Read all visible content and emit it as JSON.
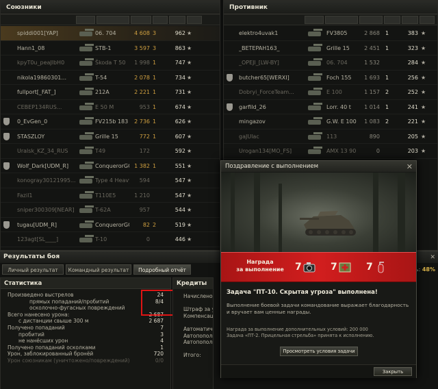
{
  "allies": {
    "title": "Союзники",
    "players": [
      {
        "name": "spiddi001[YAP]",
        "tank": "06. 704",
        "damage": "4 608",
        "kills": "3",
        "xp": "962"
      },
      {
        "name": "Hann1_08",
        "tank": "STB-1",
        "damage": "3 597",
        "kills": "3",
        "xp": "863"
      },
      {
        "name": "kpyT0u_peaJlbH0",
        "tank": "Škoda T 50",
        "damage": "1 998",
        "kills": "1",
        "xp": "747"
      },
      {
        "name": "nikola19860301...",
        "tank": "T-54",
        "damage": "2 078",
        "kills": "1",
        "xp": "734"
      },
      {
        "name": "fullport[_FAT_]",
        "tank": "212A",
        "damage": "2 221",
        "kills": "1",
        "xp": "731"
      },
      {
        "name": "CEBEP134RUS...",
        "tank": "E 50 M",
        "damage": "953",
        "kills": "1",
        "xp": "674"
      },
      {
        "name": "0_EvGen_0",
        "tank": "FV215b 183",
        "damage": "2 736",
        "kills": "1",
        "xp": "626"
      },
      {
        "name": "STASZLOY",
        "tank": "Grille 15",
        "damage": "772",
        "kills": "1",
        "xp": "607"
      },
      {
        "name": "Uralsk_KZ_34_RUS",
        "tank": "T49",
        "damage": "172",
        "kills": "",
        "xp": "592"
      },
      {
        "name": "Wolf_Dark[UDM_R]",
        "tank": "ConquerorGC",
        "damage": "1 382",
        "kills": "1",
        "xp": "551"
      },
      {
        "name": "konogray30121995...",
        "tank": "Type 4 Heavy",
        "damage": "594",
        "kills": "",
        "xp": "547"
      },
      {
        "name": "Fazil1",
        "tank": "T110E5",
        "damage": "1 210",
        "kills": "",
        "xp": "547"
      },
      {
        "name": "sniper300309[NEAR]",
        "tank": "T-62A",
        "damage": "957",
        "kills": "",
        "xp": "544"
      },
      {
        "name": "tugau[UDM_R]",
        "tank": "ConquerorGC",
        "damage": "82",
        "kills": "2",
        "xp": "519"
      },
      {
        "name": "123agt[SL____]",
        "tank": "T-10",
        "damage": "0",
        "kills": "",
        "xp": "446"
      }
    ]
  },
  "enemies": {
    "title": "Противник",
    "players": [
      {
        "name": "elektro4uvak1",
        "tank": "FV3805",
        "damage": "2 868",
        "kills": "1",
        "xp": "383"
      },
      {
        "name": "_BETEPAH163_",
        "tank": "Grille 15",
        "damage": "2 451",
        "kills": "1",
        "xp": "323"
      },
      {
        "name": "_OPEJl_[LW-BY]",
        "tank": "06. 704",
        "damage": "1 532",
        "kills": "",
        "xp": "284"
      },
      {
        "name": "butcher65[WERXI]",
        "tank": "Foch 155",
        "damage": "1 693",
        "kills": "1",
        "xp": "256"
      },
      {
        "name": "Dobryi_ForceTeam...",
        "tank": "E 100",
        "damage": "1 157",
        "kills": "2",
        "xp": "252"
      },
      {
        "name": "garfild_26",
        "tank": "Lorr. 40 t",
        "damage": "1 014",
        "kills": "1",
        "xp": "241"
      },
      {
        "name": "mingazov",
        "tank": "G.W. E 100",
        "damage": "1 083",
        "kills": "2",
        "xp": "221"
      },
      {
        "name": "gaJUlac",
        "tank": "113",
        "damage": "890",
        "kills": "",
        "xp": "205"
      },
      {
        "name": "Urogan134[MO_FS]",
        "tank": "AMX 13 90",
        "damage": "0",
        "kills": "",
        "xp": "203"
      }
    ]
  },
  "results": {
    "title": "Результаты боя",
    "tabs": [
      "Личный результат",
      "Командный результат",
      "Подробный отчёт"
    ],
    "stats_title": "Статистика",
    "credits_title": "Кредиты",
    "efficiency_label": "ость: ",
    "efficiency_value": "48%",
    "stats": [
      {
        "label": "Произведено выстрелов",
        "value": "24",
        "indent": 0
      },
      {
        "label": "прямых попаданий/пробитий",
        "value": "8/4",
        "indent": 2
      },
      {
        "label": "осколочно-фугасных повреждений",
        "value": "",
        "indent": 2
      },
      {
        "label": "Всего нанесено урона:",
        "value": "2 687",
        "indent": 0
      },
      {
        "label": "с дистанции свыше 300 м",
        "value": "2 687",
        "indent": 1
      },
      {
        "label": "Получено попаданий",
        "value": "7",
        "indent": 0
      },
      {
        "label": "пробитий",
        "value": "3",
        "indent": 1
      },
      {
        "label": "не нанёсших урон",
        "value": "4",
        "indent": 1
      },
      {
        "label": "Получено попаданий осколками",
        "value": "1",
        "indent": 0
      },
      {
        "label": "Урон, заблокированный бронёй",
        "value": "720",
        "indent": 0
      },
      {
        "label": "Урон союзникам (уничтожено/повреждений)",
        "value": "0/0",
        "indent": 0,
        "dim": true
      }
    ],
    "credits": [
      "Начислено за б",
      "",
      "Штраф за урон",
      "Компенсация з",
      "",
      "Автоматическ",
      "Автопополнени",
      "Автопополнени",
      "",
      "Итого:"
    ]
  },
  "popup": {
    "title": "Поздравление с выполнением",
    "close_glyph": "✕",
    "reward_label_1": "Награда",
    "reward_label_2": "за выполнение",
    "rewards": [
      {
        "count": "7",
        "icon": "camera-icon"
      },
      {
        "count": "7",
        "icon": "toolkit-icon"
      },
      {
        "count": "7",
        "icon": "extinguisher-icon"
      }
    ],
    "task_title": "Задача \"ПТ-10. Скрытая угроза\" выполнена!",
    "task_text": "Выполнение боевой задачи командование выражает благодарность и вручает вам ценные награды.",
    "note_line1": "Награда за выполнение дополнительных условий: 200 000",
    "note_line2": "Задача «ПТ-2. Прицельная стрельба» принята к исполнению.",
    "details_button": "Просмотреть условия задачи",
    "close_button": "Закрыть"
  }
}
